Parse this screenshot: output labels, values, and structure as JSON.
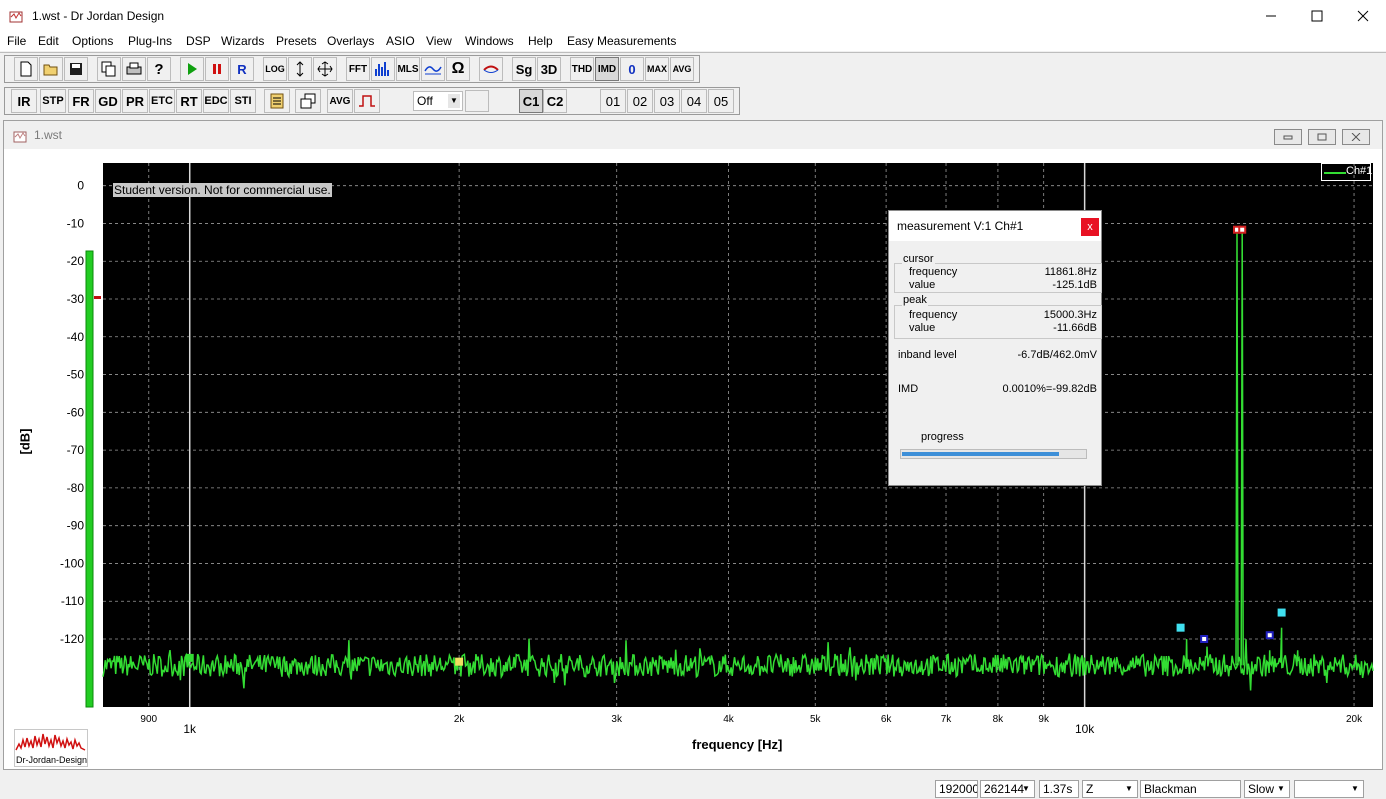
{
  "window": {
    "title": "1.wst - Dr Jordan Design"
  },
  "menu": [
    "File",
    "Edit",
    "Options",
    "Plug-Ins",
    "DSP",
    "Wizards",
    "Presets",
    "Overlays",
    "ASIO",
    "View",
    "Windows",
    "Help",
    "Easy Measurements"
  ],
  "toolbar1": {
    "buttons": [
      "FFT",
      "MLS",
      "Sg",
      "3D",
      "THD",
      "IMD",
      "0",
      "MAX",
      "AVG"
    ],
    "log_label": "LOG"
  },
  "toolbar2": {
    "buttons": [
      "IR",
      "STP",
      "FR",
      "GD",
      "PR",
      "ETC",
      "RT",
      "EDC",
      "STI"
    ],
    "avg_label": "AVG",
    "select_value": "Off",
    "channels": [
      "C1",
      "C2"
    ],
    "overlays": [
      "01",
      "02",
      "03",
      "04",
      "05"
    ]
  },
  "document": {
    "title": "1.wst"
  },
  "plot": {
    "watermark": "Student version. Not for commercial use.",
    "legend": "Ch#1",
    "ylabel": "[dB]",
    "xlabel": "frequency [Hz]",
    "logo_text": "Dr-Jordan-Design",
    "y_ticks": [
      "0",
      "-10",
      "-20",
      "-30",
      "-40",
      "-50",
      "-60",
      "-70",
      "-80",
      "-90",
      "-100",
      "-110",
      "-120"
    ],
    "x_ticks": [
      "900",
      "1k",
      "2k",
      "3k",
      "4k",
      "5k",
      "6k",
      "7k",
      "8k",
      "9k",
      "10k",
      "20k"
    ]
  },
  "chart_data": {
    "type": "line",
    "xlabel": "frequency [Hz]",
    "ylabel": "[dB]",
    "xscale": "log",
    "xlim": [
      800,
      21000
    ],
    "ylim": [
      -138,
      6
    ],
    "series": [
      {
        "name": "Ch#1",
        "color": "#33dd33"
      }
    ],
    "peaks": [
      {
        "x": 14800,
        "y": -11.66
      },
      {
        "x": 15000,
        "y": -11.66
      }
    ],
    "noise_floor": -127
  },
  "dialog": {
    "title": "measurement V:1 Ch#1",
    "close": "x",
    "cursor_group": "cursor",
    "cursor_frequency_label": "frequency",
    "cursor_frequency": "11861.8Hz",
    "cursor_value_label": "value",
    "cursor_value": "-125.1dB",
    "peak_group": "peak",
    "peak_frequency_label": "frequency",
    "peak_frequency": "15000.3Hz",
    "peak_value_label": "value",
    "peak_value": "-11.66dB",
    "inband_label": "inband level",
    "inband_value": "-6.7dB/462.0mV",
    "imd_label": "IMD",
    "imd_value": "0.0010%=-99.82dB",
    "progress_label": "progress",
    "progress": 0.86
  },
  "status": {
    "samplerate": "192000",
    "fftsize": "262144",
    "time": "1.37s",
    "z": "Z",
    "window": "Blackman",
    "speed": "Slow",
    "extra": ""
  },
  "colors": {
    "trace": "#33dd33",
    "plot_bg": "#000000",
    "marker_red": "#d32020",
    "marker_cyan": "#40e0f0",
    "marker_blue": "#2020c0",
    "marker_yellow": "#f0e060"
  }
}
